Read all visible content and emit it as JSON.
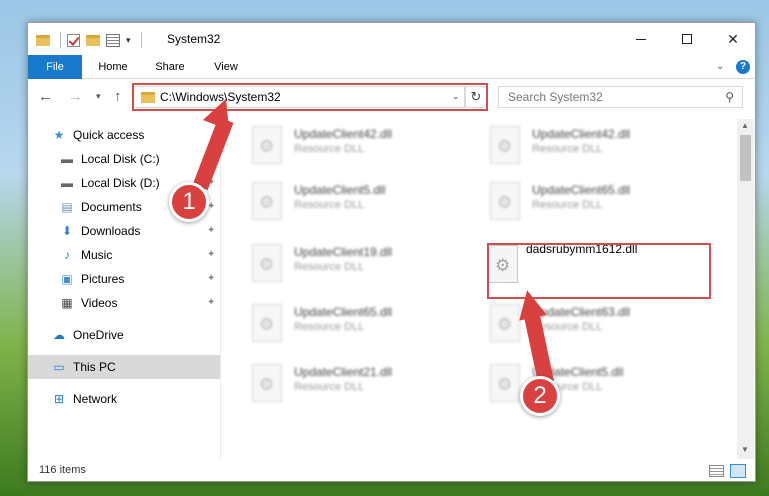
{
  "window": {
    "title": "System32"
  },
  "ribbon": {
    "tabs": [
      "File",
      "Home",
      "Share",
      "View"
    ],
    "help": "?"
  },
  "nav": {
    "address": "C:\\Windows\\System32",
    "search_placeholder": "Search System32"
  },
  "sidebar": {
    "items": [
      {
        "label": "Quick access",
        "icon": "star-icon"
      },
      {
        "label": "Local Disk (C:)",
        "icon": "drive-icon"
      },
      {
        "label": "Local Disk (D:)",
        "icon": "drive-icon"
      },
      {
        "label": "Documents",
        "icon": "documents-icon"
      },
      {
        "label": "Downloads",
        "icon": "download-icon"
      },
      {
        "label": "Music",
        "icon": "music-icon"
      },
      {
        "label": "Pictures",
        "icon": "pictures-icon"
      },
      {
        "label": "Videos",
        "icon": "videos-icon"
      },
      {
        "label": "OneDrive",
        "icon": "cloud-icon"
      },
      {
        "label": "This PC",
        "icon": "computer-icon"
      },
      {
        "label": "Network",
        "icon": "network-icon"
      }
    ]
  },
  "files": {
    "left": [
      {
        "name": "UpdateClient42.dll",
        "type": "Resource DLL"
      },
      {
        "name": "UpdateClient5.dll",
        "type": "Resource DLL"
      },
      {
        "name": "UpdateClient19.dll",
        "type": "Resource DLL"
      },
      {
        "name": "UpdateClient65.dll",
        "type": "Resource DLL"
      },
      {
        "name": "UpdateClient21.dll",
        "type": "Resource DLL"
      }
    ],
    "right": [
      {
        "name": "UpdateClient42.dll",
        "type": "Resource DLL"
      },
      {
        "name": "UpdateClient65.dll",
        "type": "Resource DLL"
      },
      {
        "name": "dadsrubymm1612.dll",
        "type": ""
      },
      {
        "name": "UpdateClient63.dll",
        "type": "Resource DLL"
      },
      {
        "name": "UpdateClient5.dll",
        "type": "Resource DLL"
      }
    ]
  },
  "status": {
    "count": "116 items"
  },
  "annotations": {
    "badge1": "1",
    "badge2": "2"
  }
}
